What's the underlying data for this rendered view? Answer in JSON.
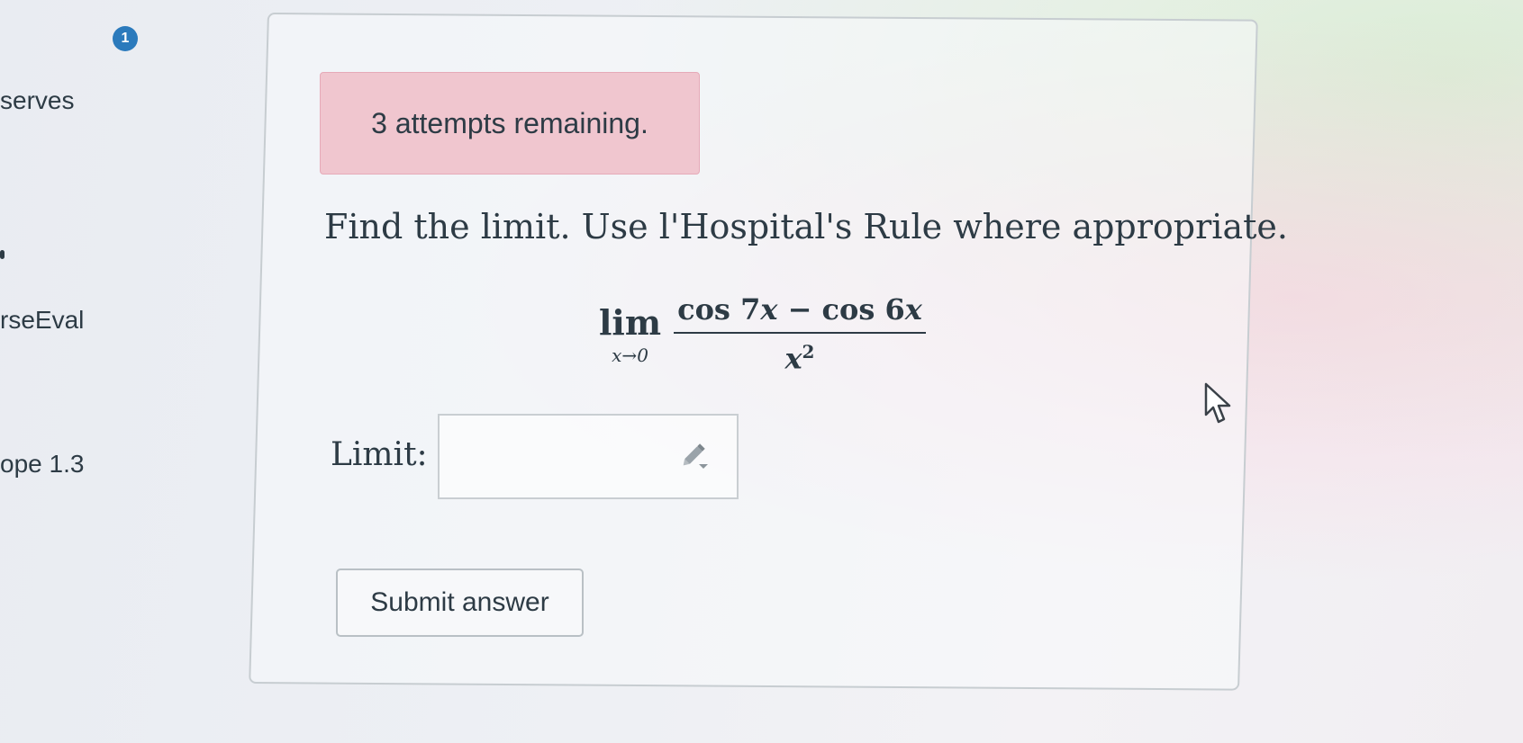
{
  "sidebar": {
    "badge": "1",
    "items": [
      "serves",
      "rseEval",
      "ope 1.3"
    ]
  },
  "question": {
    "attempts_text": "3 attempts remaining.",
    "prompt": "Find the limit. Use l'Hospital's Rule where appropriate.",
    "formula": {
      "lim": "lim",
      "subscript": "x→0",
      "numerator_a": "cos 7",
      "numerator_b": "x",
      "numerator_minus": " − cos 6",
      "numerator_c": "x",
      "denominator_var": "x",
      "denominator_exp": "2"
    },
    "limit_label": "Limit:",
    "answer_value": "",
    "submit_label": "Submit answer"
  },
  "icons": {
    "pencil": "pencil-icon",
    "cursor": "mouse-pointer-icon"
  },
  "colors": {
    "alert_background": "#f0c6cf",
    "badge": "#2b7abc",
    "text": "#2d3b45"
  }
}
